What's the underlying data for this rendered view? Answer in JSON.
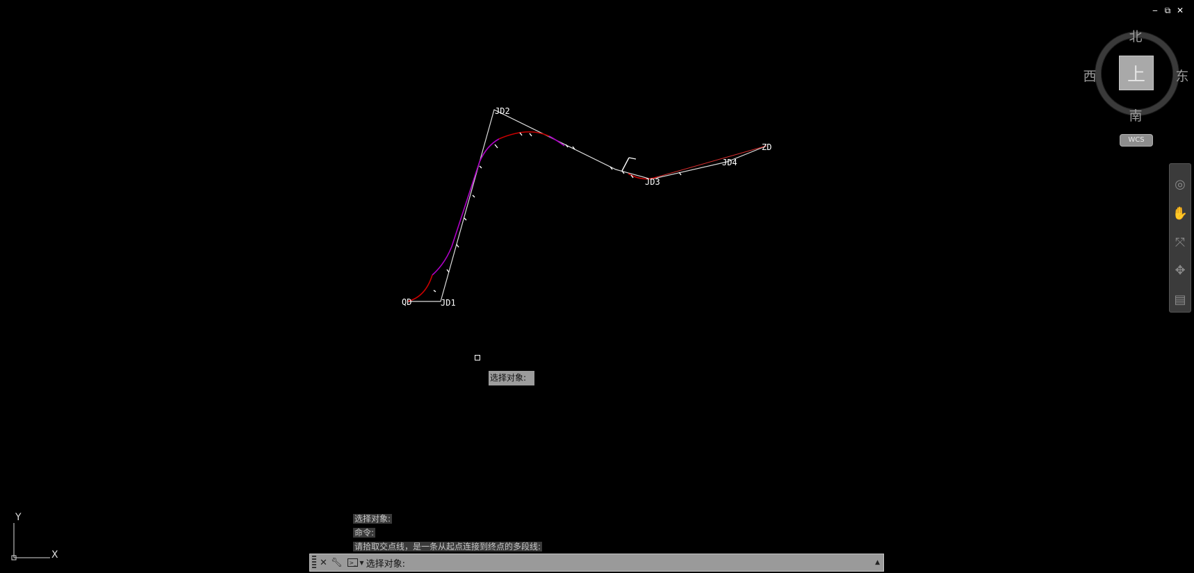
{
  "window_controls": {
    "minimize": "‒",
    "restore": "⧉",
    "close": "✕"
  },
  "viewcube": {
    "top_face": "上",
    "north": "北",
    "south": "南",
    "west": "西",
    "east": "东",
    "wcs_label": "WCS"
  },
  "drawing": {
    "labels": {
      "qd": "QD",
      "jd1": "JD1",
      "jd2": "JD2",
      "jd3": "JD3",
      "jd4": "JD4",
      "zd": "ZD"
    }
  },
  "floating_prompt": "选择对象:",
  "history": [
    "选择对象:",
    "命令:",
    "请拾取交点线，是一条从起点连接到终点的多段线:"
  ],
  "command_line": {
    "prompt": "选择对象:"
  },
  "ucs": {
    "x_label": "X",
    "y_label": "Y"
  },
  "colors": {
    "background": "#000000",
    "alignment_line": "#dddddd",
    "spiral": "#b000c8",
    "circular_curve": "#cc0000"
  }
}
